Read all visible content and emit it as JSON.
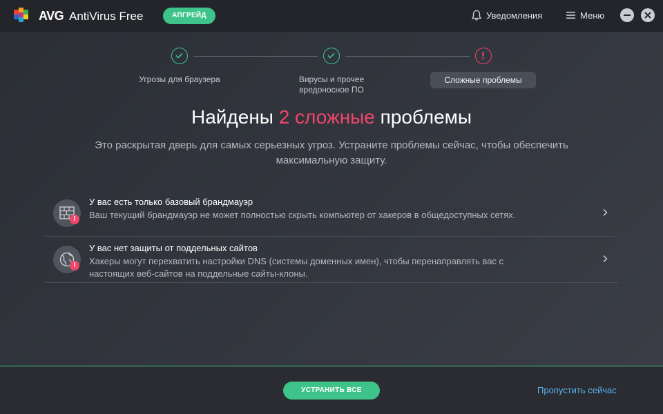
{
  "app": {
    "brand": "AVG",
    "product": "AntiVirus Free",
    "upgrade_label": "АПГРЕЙД",
    "notifications_label": "Уведомления",
    "menu_label": "Меню"
  },
  "steps": [
    {
      "label": "Угрозы для браузера",
      "status": "done"
    },
    {
      "label": "Вирусы и прочее вредоносное ПО",
      "status": "done"
    },
    {
      "label": "Сложные проблемы",
      "status": "alert"
    }
  ],
  "headline": {
    "prefix": "Найдены ",
    "highlight": "2 сложные",
    "suffix": " проблемы"
  },
  "subline": "Это раскрытая дверь для самых серьезных угроз. Устраните проблемы сейчас, чтобы обеспечить максимальную защиту.",
  "issues": [
    {
      "icon": "firewall-icon",
      "title": "У вас есть только базовый брандмауэр",
      "description": "Ваш текущий брандмауэр не может полностью скрыть компьютер от хакеров в общедоступных сетях."
    },
    {
      "icon": "globe-icon",
      "title": "У вас нет защиты от поддельных сайтов",
      "description": "Хакеры могут перехватить настройки DNS (системы доменных имен), чтобы перенаправлять вас с настоящих веб-сайтов на поддельные сайты-клоны."
    }
  ],
  "footer": {
    "fix_all_label": "УСТРАНИТЬ ВСЕ",
    "skip_label": "Пропустить сейчас"
  },
  "colors": {
    "accent_green": "#3ec48a",
    "alert_red": "#f0466a",
    "link_blue": "#5ab4f0"
  }
}
